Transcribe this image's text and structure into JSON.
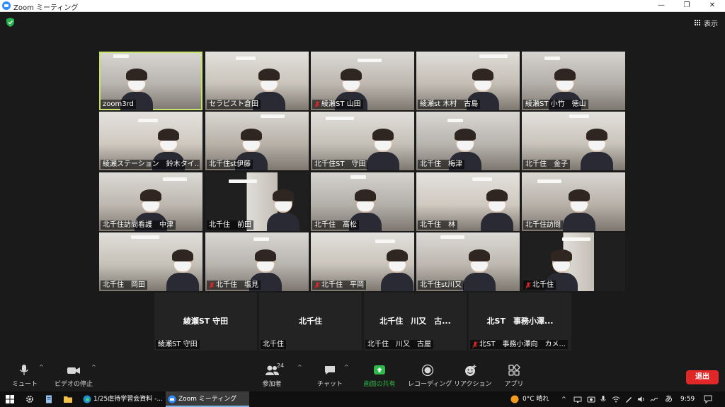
{
  "window": {
    "title": "Zoom ミーティング",
    "minimize": "—",
    "restore": "❐",
    "close": "✕"
  },
  "top_right": {
    "view_label": "表示"
  },
  "participants": [
    {
      "name": "zoom3rd",
      "muted": false,
      "active": true
    },
    {
      "name": "セラピスト倉田",
      "muted": false
    },
    {
      "name": "綾瀬ST 山田",
      "muted": true
    },
    {
      "name": "綾瀬st 木村　古島",
      "muted": false
    },
    {
      "name": "綾瀬ST 小竹　徳山",
      "muted": false
    },
    {
      "name": "綾瀬ステーション　鈴木タイ...",
      "muted": false
    },
    {
      "name": "北千住st伊藤",
      "muted": false
    },
    {
      "name": "北千住ST　守田",
      "muted": false
    },
    {
      "name": "北千住　梅津",
      "muted": false
    },
    {
      "name": "北千住　金子",
      "muted": false
    },
    {
      "name": "北千住訪問看護　中津",
      "muted": false
    },
    {
      "name": "北千住　前田",
      "muted": false
    },
    {
      "name": "北千住　高松",
      "muted": false
    },
    {
      "name": "北千住　林",
      "muted": false
    },
    {
      "name": "北千住訪問",
      "muted": false
    },
    {
      "name": "北千住　岡田",
      "muted": false
    },
    {
      "name": "北千住　塩見",
      "muted": true
    },
    {
      "name": "北千住　平岡",
      "muted": true
    },
    {
      "name": "北千住st川又",
      "muted": false
    },
    {
      "name": "北千住",
      "muted": true
    }
  ],
  "name_only_tiles": [
    {
      "center": "綾瀬ST 守田",
      "label": "綾瀬ST 守田",
      "muted": false
    },
    {
      "center": "北千住",
      "label": "北千住",
      "muted": false
    },
    {
      "center": "北千住　川又　古...",
      "label": "北千住　川又　古屋",
      "muted": false
    },
    {
      "center": "北ST　事務小澤...",
      "label": "北ST　事務小澤向　カメ...",
      "muted": true
    }
  ],
  "toolbar": {
    "mute": "ミュート",
    "video": "ビデオの停止",
    "participants": "参加者",
    "participants_count": "24",
    "chat": "チャット",
    "share": "画面の共有",
    "record": "レコーディング",
    "reactions": "リアクション",
    "apps": "アプリ",
    "leave": "退出",
    "caret": "^"
  },
  "taskbar": {
    "task_1": "1/25虐待学習会資料 -...",
    "task_2": "Zoom ミーティング",
    "weather": "0°C 晴れ",
    "ime": "あ",
    "time": "9:59",
    "up_caret": "^"
  },
  "colors": {
    "share_green": "#2fb84b",
    "leave_red": "#e02828",
    "active_speaker": "#c7e36b"
  }
}
